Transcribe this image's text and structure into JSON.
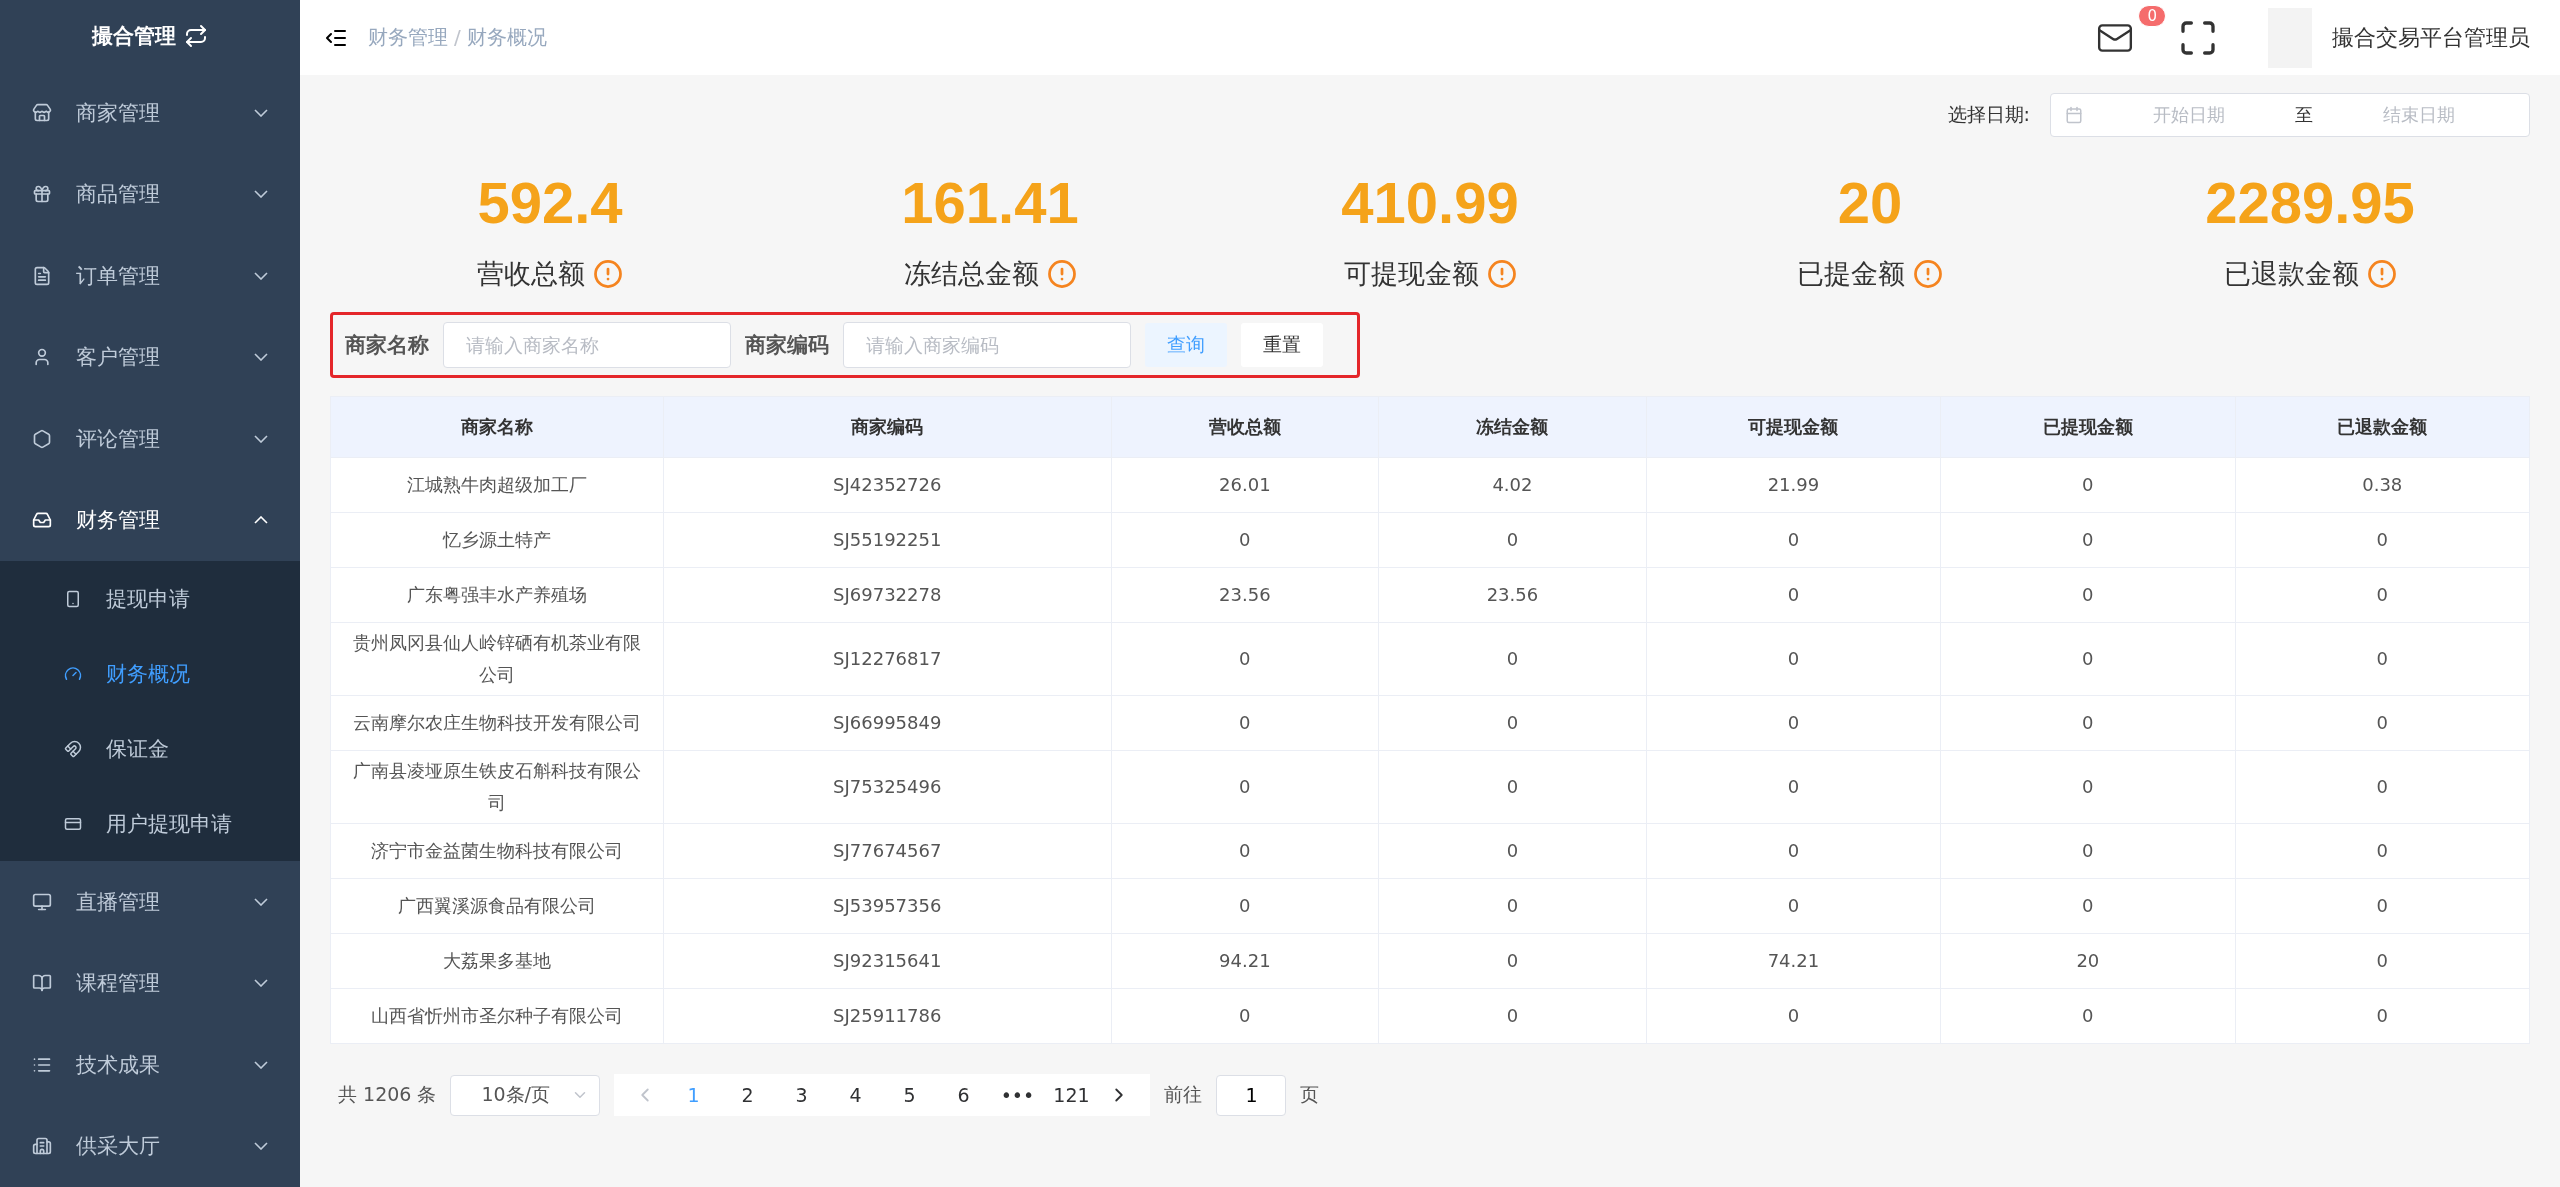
{
  "sidebar": {
    "title": "撮合管理",
    "items": [
      {
        "label": "商家管理",
        "expanded": false
      },
      {
        "label": "商品管理",
        "expanded": false
      },
      {
        "label": "订单管理",
        "expanded": false
      },
      {
        "label": "客户管理",
        "expanded": false
      },
      {
        "label": "评论管理",
        "expanded": false
      },
      {
        "label": "财务管理",
        "expanded": true,
        "children": [
          {
            "label": "提现申请",
            "selected": false
          },
          {
            "label": "财务概况",
            "selected": true
          },
          {
            "label": "保证金",
            "selected": false
          },
          {
            "label": "用户提现申请",
            "selected": false
          }
        ]
      },
      {
        "label": "直播管理",
        "expanded": false
      },
      {
        "label": "课程管理",
        "expanded": false
      },
      {
        "label": "技术成果",
        "expanded": false
      },
      {
        "label": "供采大厅",
        "expanded": false
      }
    ]
  },
  "header": {
    "breadcrumb": [
      "财务管理",
      "财务概况"
    ],
    "breadcrumb_separator": "/",
    "mail_badge": "0",
    "user": "撮合交易平台管理员"
  },
  "date_filter": {
    "label": "选择日期:",
    "start_placeholder": "开始日期",
    "separator": "至",
    "end_placeholder": "结束日期"
  },
  "stats": [
    {
      "value": "592.4",
      "label": "营收总额"
    },
    {
      "value": "161.41",
      "label": "冻结总金额"
    },
    {
      "value": "410.99",
      "label": "可提现金额"
    },
    {
      "value": "20",
      "label": "已提金额"
    },
    {
      "value": "2289.95",
      "label": "已退款金额"
    }
  ],
  "search": {
    "fields": [
      {
        "label": "商家名称",
        "placeholder": "请输入商家名称"
      },
      {
        "label": "商家编码",
        "placeholder": "请输入商家编码"
      }
    ],
    "buttons": [
      {
        "label": "查询",
        "kind": "primary"
      },
      {
        "label": "重置",
        "kind": "default"
      }
    ]
  },
  "table": {
    "columns": [
      "商家名称",
      "商家编码",
      "营收总额",
      "冻结金额",
      "可提现金额",
      "已提现金额",
      "已退款金额"
    ],
    "rows": [
      [
        "江城熟牛肉超级加工厂",
        "SJ42352726",
        "26.01",
        "4.02",
        "21.99",
        "0",
        "0.38"
      ],
      [
        "忆乡源土特产",
        "SJ55192251",
        "0",
        "0",
        "0",
        "0",
        "0"
      ],
      [
        "广东粤强丰水产养殖场",
        "SJ69732278",
        "23.56",
        "23.56",
        "0",
        "0",
        "0"
      ],
      [
        "贵州凤冈县仙人岭锌硒有机茶业有限公司",
        "SJ12276817",
        "0",
        "0",
        "0",
        "0",
        "0"
      ],
      [
        "云南摩尔农庄生物科技开发有限公司",
        "SJ66995849",
        "0",
        "0",
        "0",
        "0",
        "0"
      ],
      [
        "广南县凌垭原生铁皮石斛科技有限公司",
        "SJ75325496",
        "0",
        "0",
        "0",
        "0",
        "0"
      ],
      [
        "济宁市金益菌生物科技有限公司",
        "SJ77674567",
        "0",
        "0",
        "0",
        "0",
        "0"
      ],
      [
        "广西翼溪源食品有限公司",
        "SJ53957356",
        "0",
        "0",
        "0",
        "0",
        "0"
      ],
      [
        "大荔果多基地",
        "SJ92315641",
        "94.21",
        "0",
        "74.21",
        "20",
        "0"
      ],
      [
        "山西省忻州市圣尔种子有限公司",
        "SJ25911786",
        "0",
        "0",
        "0",
        "0",
        "0"
      ]
    ]
  },
  "pagination": {
    "total": "共 1206 条",
    "page_size": "10条/页",
    "pages": [
      {
        "label": "1",
        "selected": true
      },
      {
        "label": "2",
        "selected": false
      },
      {
        "label": "3",
        "selected": false
      },
      {
        "label": "4",
        "selected": false
      },
      {
        "label": "5",
        "selected": false
      },
      {
        "label": "6",
        "selected": false
      },
      {
        "label": "•••",
        "selected": false
      },
      {
        "label": "121",
        "selected": false
      }
    ],
    "goto_label": "前往",
    "goto_value": "1",
    "goto_suffix": "页"
  }
}
